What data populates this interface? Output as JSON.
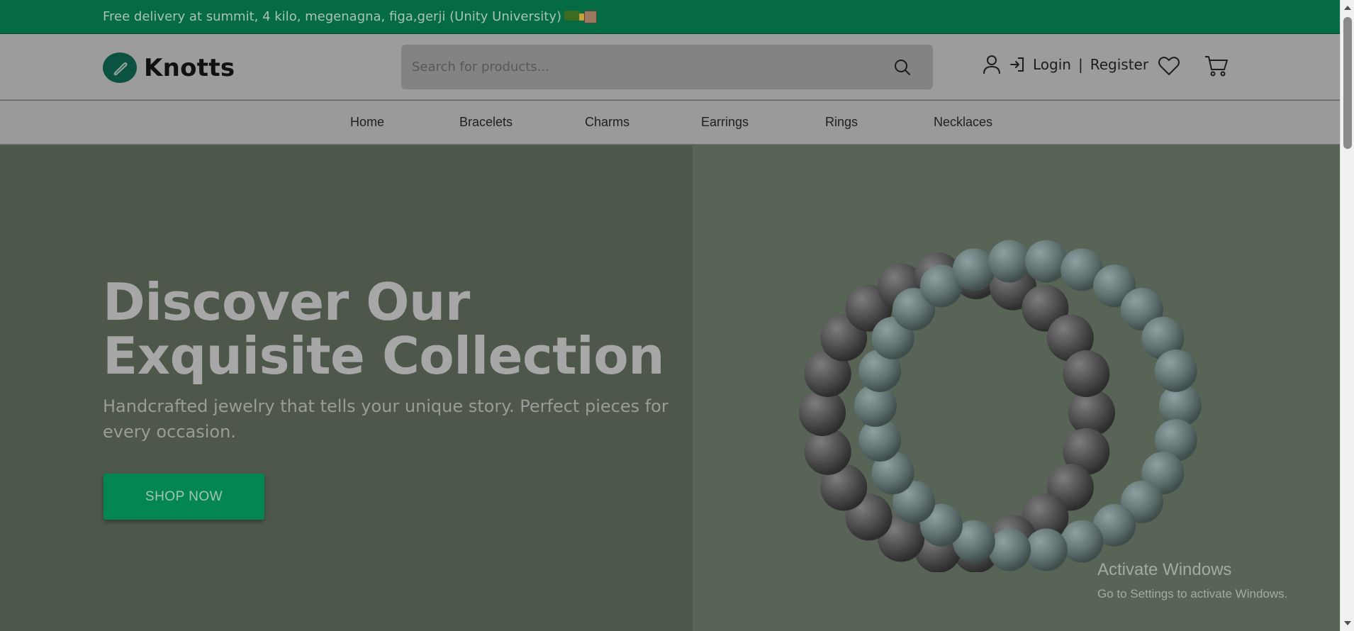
{
  "announcement": {
    "text": "Free delivery at summit, 4 kilo, megenagna, figa,gerji (Unity University)",
    "emoji_icons": [
      "truck-icon",
      "package-icon"
    ]
  },
  "header": {
    "logo_text": "Knotts",
    "logo_icon": "pen-leaf-icon",
    "search_placeholder": "Search for products...",
    "login_label": "Login",
    "separator": "|",
    "register_label": "Register"
  },
  "nav": {
    "items": [
      {
        "label": "Home"
      },
      {
        "label": "Bracelets"
      },
      {
        "label": "Charms"
      },
      {
        "label": "Earrings"
      },
      {
        "label": "Rings"
      },
      {
        "label": "Necklaces"
      }
    ]
  },
  "hero": {
    "title_line1": "Discover Our",
    "title_line2": "Exquisite Collection",
    "subtitle": "Handcrafted jewelry that tells your unique story. Perfect pieces for every occasion.",
    "cta_label": "SHOP NOW"
  },
  "watermark": {
    "title": "Activate Windows",
    "subtitle": "Go to Settings to activate Windows."
  },
  "colors": {
    "brand_green": "#056b45",
    "button_green": "#038650",
    "logo_green": "#0b5340"
  }
}
